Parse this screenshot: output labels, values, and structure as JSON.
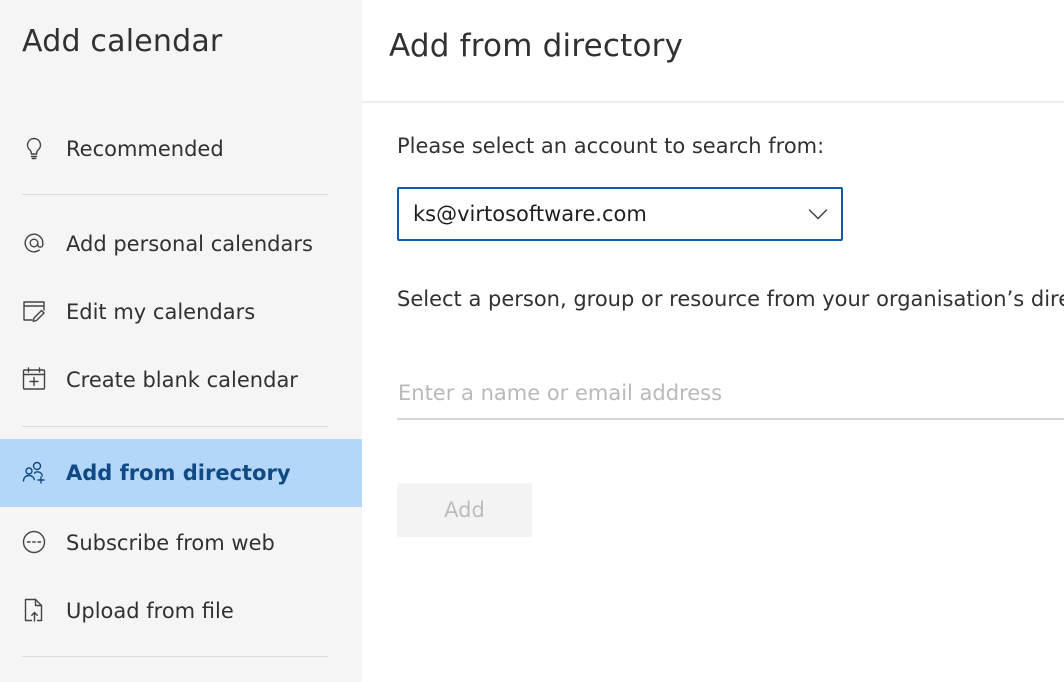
{
  "sidebar": {
    "title": "Add calendar",
    "items": [
      {
        "label": "Recommended",
        "icon": "lightbulb-icon"
      },
      {
        "label": "Add personal calendars",
        "icon": "at-icon"
      },
      {
        "label": "Edit my calendars",
        "icon": "edit-calendar-icon"
      },
      {
        "label": "Create blank calendar",
        "icon": "calendar-add-icon"
      },
      {
        "label": "Add from directory",
        "icon": "people-icon",
        "selected": true
      },
      {
        "label": "Subscribe from web",
        "icon": "link-circle-icon"
      },
      {
        "label": "Upload from file",
        "icon": "file-upload-icon"
      }
    ]
  },
  "main": {
    "title": "Add from directory",
    "account_prompt": "Please select an account to search from:",
    "account_selected": "ks@virtosoftware.com",
    "directory_prompt": "Select a person, group or resource from your organisation’s directory",
    "search_placeholder": "Enter a name or email address",
    "add_label": "Add"
  },
  "colors": {
    "sidebar_bg": "#f5f5f5",
    "selected_bg": "#b3d6f9",
    "selected_text": "#0f4a85",
    "focus_border": "#0f5aa8"
  }
}
